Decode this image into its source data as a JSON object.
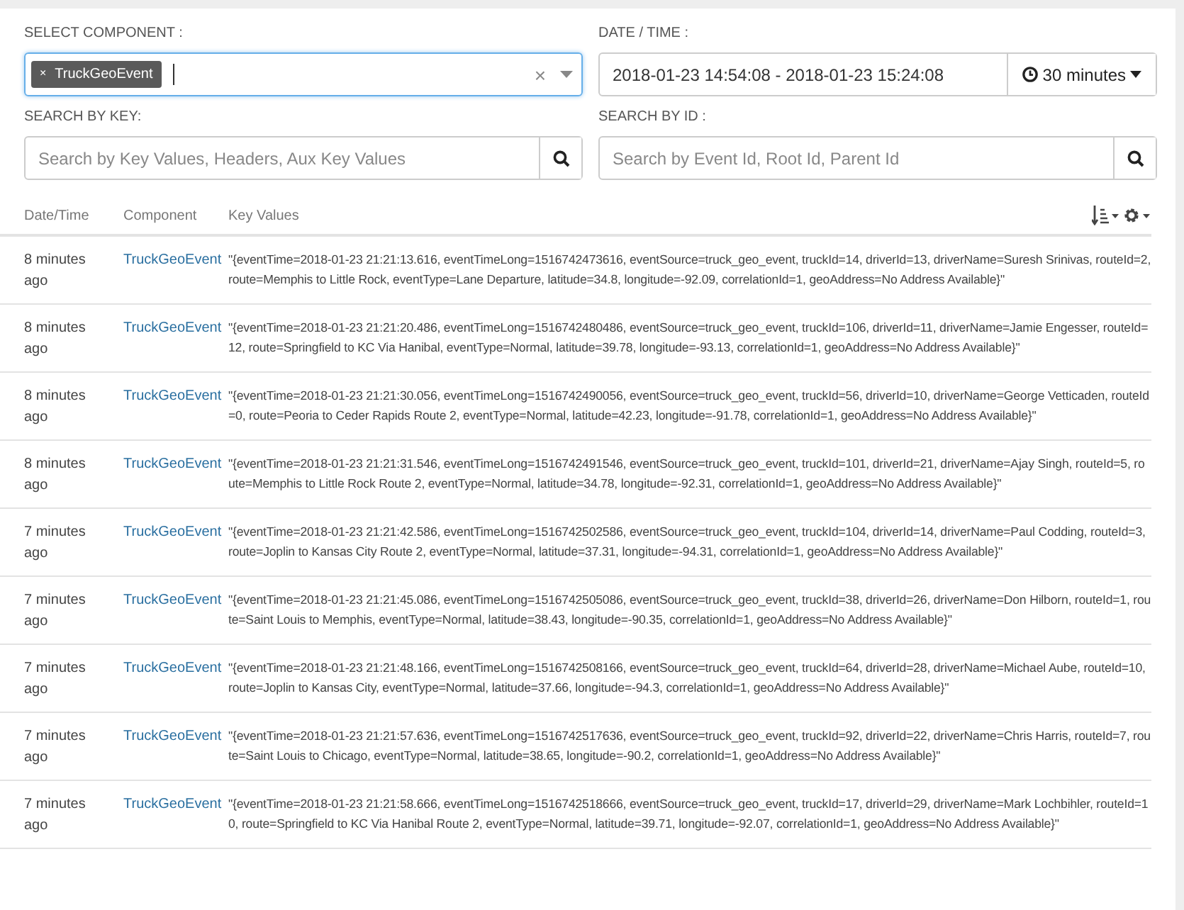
{
  "filters": {
    "component": {
      "label": "SELECT COMPONENT :",
      "tags": [
        {
          "remove": "×",
          "label": "TruckGeoEvent"
        }
      ],
      "clear": "×"
    },
    "date_time": {
      "label": "DATE / TIME :",
      "value": "2018-01-23 14:54:08 - 2018-01-23 15:24:08",
      "range": "30 minutes"
    },
    "search_key": {
      "label": "SEARCH BY KEY:",
      "placeholder": "Search by Key Values, Headers, Aux Key Values"
    },
    "search_id": {
      "label": "SEARCH BY ID :",
      "placeholder": "Search by Event Id, Root Id, Parent Id"
    }
  },
  "table": {
    "columns": [
      "Date/Time",
      "Component",
      "Key Values"
    ],
    "rows": [
      {
        "time": "8 minutes ago",
        "component": "TruckGeoEvent",
        "values": "\"{eventTime=2018-01-23 21:21:13.616, eventTimeLong=1516742473616, eventSource=truck_geo_event, truckId=14, driverId=13, driverName=Suresh Srinivas, routeId=2, route=Memphis to Little Rock, eventType=Lane Departure, latitude=34.8, longitude=-92.09, correlationId=1, geoAddress=No Address Available}\""
      },
      {
        "time": "8 minutes ago",
        "component": "TruckGeoEvent",
        "values": "\"{eventTime=2018-01-23 21:21:20.486, eventTimeLong=1516742480486, eventSource=truck_geo_event, truckId=106, driverId=11, driverName=Jamie Engesser, routeId=12, route=Springfield to KC Via Hanibal, eventType=Normal, latitude=39.78, longitude=-93.13, correlationId=1, geoAddress=No Address Available}\""
      },
      {
        "time": "8 minutes ago",
        "component": "TruckGeoEvent",
        "values": "\"{eventTime=2018-01-23 21:21:30.056, eventTimeLong=1516742490056, eventSource=truck_geo_event, truckId=56, driverId=10, driverName=George Vetticaden, routeId=0, route=Peoria to Ceder Rapids Route 2, eventType=Normal, latitude=42.23, longitude=-91.78, correlationId=1, geoAddress=No Address Available}\""
      },
      {
        "time": "8 minutes ago",
        "component": "TruckGeoEvent",
        "values": "\"{eventTime=2018-01-23 21:21:31.546, eventTimeLong=1516742491546, eventSource=truck_geo_event, truckId=101, driverId=21, driverName=Ajay Singh, routeId=5, route=Memphis to Little Rock Route 2, eventType=Normal, latitude=34.78, longitude=-92.31, correlationId=1, geoAddress=No Address Available}\""
      },
      {
        "time": "7 minutes ago",
        "component": "TruckGeoEvent",
        "values": "\"{eventTime=2018-01-23 21:21:42.586, eventTimeLong=1516742502586, eventSource=truck_geo_event, truckId=104, driverId=14, driverName=Paul Codding, routeId=3, route=Joplin to Kansas City Route 2, eventType=Normal, latitude=37.31, longitude=-94.31, correlationId=1, geoAddress=No Address Available}\""
      },
      {
        "time": "7 minutes ago",
        "component": "TruckGeoEvent",
        "values": "\"{eventTime=2018-01-23 21:21:45.086, eventTimeLong=1516742505086, eventSource=truck_geo_event, truckId=38, driverId=26, driverName=Don Hilborn, routeId=1, route=Saint Louis to Memphis, eventType=Normal, latitude=38.43, longitude=-90.35, correlationId=1, geoAddress=No Address Available}\""
      },
      {
        "time": "7 minutes ago",
        "component": "TruckGeoEvent",
        "values": "\"{eventTime=2018-01-23 21:21:48.166, eventTimeLong=1516742508166, eventSource=truck_geo_event, truckId=64, driverId=28, driverName=Michael Aube, routeId=10, route=Joplin to Kansas City, eventType=Normal, latitude=37.66, longitude=-94.3, correlationId=1, geoAddress=No Address Available}\""
      },
      {
        "time": "7 minutes ago",
        "component": "TruckGeoEvent",
        "values": "\"{eventTime=2018-01-23 21:21:57.636, eventTimeLong=1516742517636, eventSource=truck_geo_event, truckId=92, driverId=22, driverName=Chris Harris, routeId=7, route=Saint Louis to Chicago, eventType=Normal, latitude=38.65, longitude=-90.2, correlationId=1, geoAddress=No Address Available}\""
      },
      {
        "time": "7 minutes ago",
        "component": "TruckGeoEvent",
        "values": "\"{eventTime=2018-01-23 21:21:58.666, eventTimeLong=1516742518666, eventSource=truck_geo_event, truckId=17, driverId=29, driverName=Mark Lochbihler, routeId=10, route=Springfield to KC Via Hanibal Route 2, eventType=Normal, latitude=39.71, longitude=-92.07, correlationId=1, geoAddress=No Address Available}\""
      }
    ]
  }
}
